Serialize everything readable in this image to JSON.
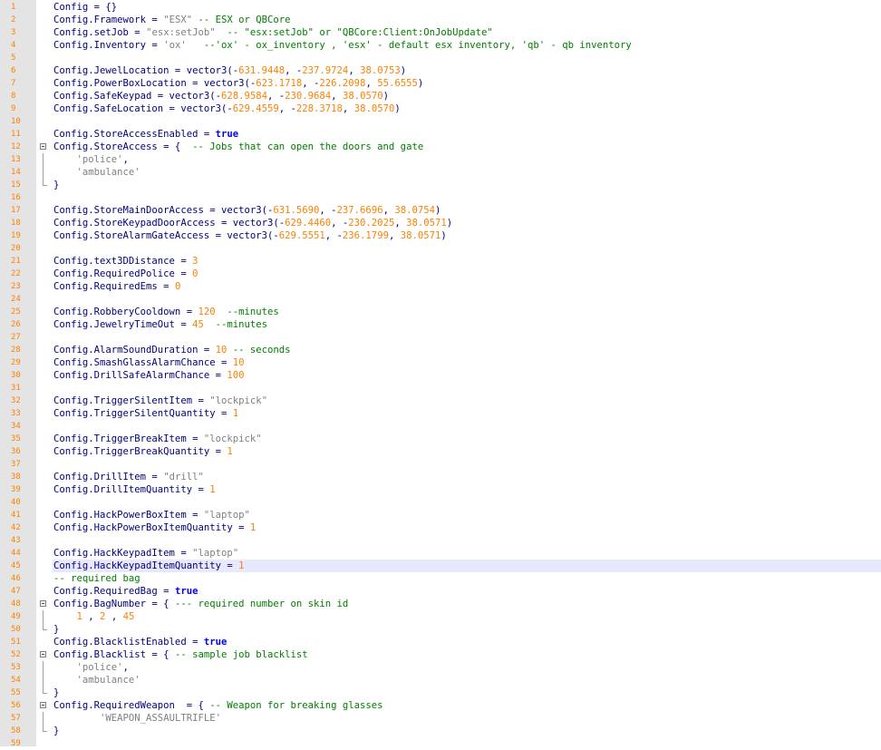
{
  "current_line": 45,
  "colors": {
    "default": "#000080",
    "string": "#808080",
    "number": "#ff8000",
    "keyword": "#0000ff",
    "comment": "#008000",
    "gutter": "#e4e4e4",
    "current_line": "#e8e8ff"
  },
  "lines": [
    {
      "n": "1",
      "fold": "",
      "t": [
        [
          "Config = {}",
          "p"
        ]
      ]
    },
    {
      "n": "2",
      "fold": "",
      "t": [
        [
          "Config.Framework = ",
          "p"
        ],
        [
          "\"ESX\"",
          "s"
        ],
        [
          " -- ESX or QBCore",
          "c"
        ]
      ]
    },
    {
      "n": "3",
      "fold": "",
      "t": [
        [
          "Config.setJob = ",
          "p"
        ],
        [
          "\"esx:setJob\"",
          "s"
        ],
        [
          "  -- \"esx:setJob\" or \"QBCore:Client:OnJobUpdate\"",
          "c"
        ]
      ]
    },
    {
      "n": "4",
      "fold": "",
      "t": [
        [
          "Config.Inventory = ",
          "p"
        ],
        [
          "'ox'",
          "s"
        ],
        [
          "   --'ox' - ox_inventory , 'esx' - default esx inventory, 'qb' - qb inventory",
          "c"
        ]
      ]
    },
    {
      "n": "5",
      "fold": "",
      "t": []
    },
    {
      "n": "6",
      "fold": "",
      "t": [
        [
          "Config.JewelLocation = vector3(-",
          "p"
        ],
        [
          "631.9448",
          "n"
        ],
        [
          ", -",
          "p"
        ],
        [
          "237.9724",
          "n"
        ],
        [
          ", ",
          "p"
        ],
        [
          "38.0753",
          "n"
        ],
        [
          ")",
          "p"
        ]
      ]
    },
    {
      "n": "7",
      "fold": "",
      "t": [
        [
          "Config.PowerBoxLocation = vector3(-",
          "p"
        ],
        [
          "623.1718",
          "n"
        ],
        [
          ", -",
          "p"
        ],
        [
          "226.2098",
          "n"
        ],
        [
          ", ",
          "p"
        ],
        [
          "55.6555",
          "n"
        ],
        [
          ")",
          "p"
        ]
      ]
    },
    {
      "n": "8",
      "fold": "",
      "t": [
        [
          "Config.SafeKeypad = vector3(-",
          "p"
        ],
        [
          "628.9584",
          "n"
        ],
        [
          ", -",
          "p"
        ],
        [
          "230.9684",
          "n"
        ],
        [
          ", ",
          "p"
        ],
        [
          "38.0570",
          "n"
        ],
        [
          ")",
          "p"
        ]
      ]
    },
    {
      "n": "9",
      "fold": "",
      "t": [
        [
          "Config.SafeLocation = vector3(-",
          "p"
        ],
        [
          "629.4559",
          "n"
        ],
        [
          ", -",
          "p"
        ],
        [
          "228.3718",
          "n"
        ],
        [
          ", ",
          "p"
        ],
        [
          "38.0570",
          "n"
        ],
        [
          ")",
          "p"
        ]
      ]
    },
    {
      "n": "10",
      "fold": "",
      "t": []
    },
    {
      "n": "11",
      "fold": "",
      "t": [
        [
          "Config.StoreAccessEnabled = ",
          "p"
        ],
        [
          "true",
          "k"
        ]
      ]
    },
    {
      "n": "12",
      "fold": "open",
      "t": [
        [
          "Config.StoreAccess = {  ",
          "p"
        ],
        [
          "-- Jobs that can open the doors and gate",
          "c"
        ]
      ]
    },
    {
      "n": "13",
      "fold": "line",
      "t": [
        [
          "    ",
          "p"
        ],
        [
          "'police'",
          "s"
        ],
        [
          ",",
          "p"
        ]
      ]
    },
    {
      "n": "14",
      "fold": "line",
      "t": [
        [
          "    ",
          "p"
        ],
        [
          "'ambulance'",
          "s"
        ]
      ]
    },
    {
      "n": "15",
      "fold": "end",
      "t": [
        [
          "}",
          "p"
        ]
      ]
    },
    {
      "n": "16",
      "fold": "",
      "t": []
    },
    {
      "n": "17",
      "fold": "",
      "t": [
        [
          "Config.StoreMainDoorAccess = vector3(-",
          "p"
        ],
        [
          "631.5690",
          "n"
        ],
        [
          ", -",
          "p"
        ],
        [
          "237.6696",
          "n"
        ],
        [
          ", ",
          "p"
        ],
        [
          "38.0754",
          "n"
        ],
        [
          ")",
          "p"
        ]
      ]
    },
    {
      "n": "18",
      "fold": "",
      "t": [
        [
          "Config.StoreKeypadDoorAccess = vector3(-",
          "p"
        ],
        [
          "629.4460",
          "n"
        ],
        [
          ", -",
          "p"
        ],
        [
          "230.2025",
          "n"
        ],
        [
          ", ",
          "p"
        ],
        [
          "38.0571",
          "n"
        ],
        [
          ")",
          "p"
        ]
      ]
    },
    {
      "n": "19",
      "fold": "",
      "t": [
        [
          "Config.StoreAlarmGateAccess = vector3(-",
          "p"
        ],
        [
          "629.5551",
          "n"
        ],
        [
          ", -",
          "p"
        ],
        [
          "236.1799",
          "n"
        ],
        [
          ", ",
          "p"
        ],
        [
          "38.0571",
          "n"
        ],
        [
          ")",
          "p"
        ]
      ]
    },
    {
      "n": "20",
      "fold": "",
      "t": []
    },
    {
      "n": "21",
      "fold": "",
      "t": [
        [
          "Config.text3DDistance = ",
          "p"
        ],
        [
          "3",
          "n"
        ]
      ]
    },
    {
      "n": "22",
      "fold": "",
      "t": [
        [
          "Config.RequiredPolice = ",
          "p"
        ],
        [
          "0",
          "n"
        ]
      ]
    },
    {
      "n": "23",
      "fold": "",
      "t": [
        [
          "Config.RequiredEms = ",
          "p"
        ],
        [
          "0",
          "n"
        ]
      ]
    },
    {
      "n": "24",
      "fold": "",
      "t": []
    },
    {
      "n": "25",
      "fold": "",
      "t": [
        [
          "Config.RobberyCooldown = ",
          "p"
        ],
        [
          "120",
          "n"
        ],
        [
          "  --minutes",
          "c"
        ]
      ]
    },
    {
      "n": "26",
      "fold": "",
      "t": [
        [
          "Config.JewelryTimeOut = ",
          "p"
        ],
        [
          "45",
          "n"
        ],
        [
          "  --minutes",
          "c"
        ]
      ]
    },
    {
      "n": "27",
      "fold": "",
      "t": []
    },
    {
      "n": "28",
      "fold": "",
      "t": [
        [
          "Config.AlarmSoundDuration = ",
          "p"
        ],
        [
          "10",
          "n"
        ],
        [
          " -- seconds",
          "c"
        ]
      ]
    },
    {
      "n": "29",
      "fold": "",
      "t": [
        [
          "Config.SmashGlassAlarmChance = ",
          "p"
        ],
        [
          "10",
          "n"
        ]
      ]
    },
    {
      "n": "30",
      "fold": "",
      "t": [
        [
          "Config.DrillSafeAlarmChance = ",
          "p"
        ],
        [
          "100",
          "n"
        ]
      ]
    },
    {
      "n": "31",
      "fold": "",
      "t": []
    },
    {
      "n": "32",
      "fold": "",
      "t": [
        [
          "Config.TriggerSilentItem = ",
          "p"
        ],
        [
          "\"lockpick\"",
          "s"
        ]
      ]
    },
    {
      "n": "33",
      "fold": "",
      "t": [
        [
          "Config.TriggerSilentQuantity = ",
          "p"
        ],
        [
          "1",
          "n"
        ]
      ]
    },
    {
      "n": "34",
      "fold": "",
      "t": []
    },
    {
      "n": "35",
      "fold": "",
      "t": [
        [
          "Config.TriggerBreakItem = ",
          "p"
        ],
        [
          "\"lockpick\"",
          "s"
        ]
      ]
    },
    {
      "n": "36",
      "fold": "",
      "t": [
        [
          "Config.TriggerBreakQuantity = ",
          "p"
        ],
        [
          "1",
          "n"
        ]
      ]
    },
    {
      "n": "37",
      "fold": "",
      "t": []
    },
    {
      "n": "38",
      "fold": "",
      "t": [
        [
          "Config.DrillItem = ",
          "p"
        ],
        [
          "\"drill\"",
          "s"
        ]
      ]
    },
    {
      "n": "39",
      "fold": "",
      "t": [
        [
          "Config.DrillItemQuantity = ",
          "p"
        ],
        [
          "1",
          "n"
        ]
      ]
    },
    {
      "n": "40",
      "fold": "",
      "t": []
    },
    {
      "n": "41",
      "fold": "",
      "t": [
        [
          "Config.HackPowerBoxItem = ",
          "p"
        ],
        [
          "\"laptop\"",
          "s"
        ]
      ]
    },
    {
      "n": "42",
      "fold": "",
      "t": [
        [
          "Config.HackPowerBoxItemQuantity = ",
          "p"
        ],
        [
          "1",
          "n"
        ]
      ]
    },
    {
      "n": "43",
      "fold": "",
      "t": []
    },
    {
      "n": "44",
      "fold": "",
      "t": [
        [
          "Config.HackKeypadItem = ",
          "p"
        ],
        [
          "\"laptop\"",
          "s"
        ]
      ]
    },
    {
      "n": "45",
      "fold": "",
      "t": [
        [
          "Config.HackKeypadItemQuantity = ",
          "p"
        ],
        [
          "1",
          "n"
        ]
      ]
    },
    {
      "n": "46",
      "fold": "",
      "t": [
        [
          "-- required bag",
          "c"
        ]
      ]
    },
    {
      "n": "47",
      "fold": "",
      "t": [
        [
          "Config.RequiredBag = ",
          "p"
        ],
        [
          "true",
          "k"
        ]
      ]
    },
    {
      "n": "48",
      "fold": "open",
      "t": [
        [
          "Config.BagNumber = { ",
          "p"
        ],
        [
          "--- required number on skin id",
          "c"
        ]
      ]
    },
    {
      "n": "49",
      "fold": "line",
      "t": [
        [
          "    ",
          "p"
        ],
        [
          "1",
          "n"
        ],
        [
          " , ",
          "p"
        ],
        [
          "2",
          "n"
        ],
        [
          " , ",
          "p"
        ],
        [
          "45",
          "n"
        ]
      ]
    },
    {
      "n": "50",
      "fold": "end",
      "t": [
        [
          "}",
          "p"
        ]
      ]
    },
    {
      "n": "51",
      "fold": "",
      "t": [
        [
          "Config.BlacklistEnabled = ",
          "p"
        ],
        [
          "true",
          "k"
        ]
      ]
    },
    {
      "n": "52",
      "fold": "open",
      "t": [
        [
          "Config.Blacklist = { ",
          "p"
        ],
        [
          "-- sample job blacklist",
          "c"
        ]
      ]
    },
    {
      "n": "53",
      "fold": "line",
      "t": [
        [
          "    ",
          "p"
        ],
        [
          "'police'",
          "s"
        ],
        [
          ",",
          "p"
        ]
      ]
    },
    {
      "n": "54",
      "fold": "line",
      "t": [
        [
          "    ",
          "p"
        ],
        [
          "'ambulance'",
          "s"
        ]
      ]
    },
    {
      "n": "55",
      "fold": "end",
      "t": [
        [
          "}",
          "p"
        ]
      ]
    },
    {
      "n": "56",
      "fold": "open",
      "t": [
        [
          "Config.RequiredWeapon  = { ",
          "p"
        ],
        [
          "-- Weapon for breaking glasses",
          "c"
        ]
      ]
    },
    {
      "n": "57",
      "fold": "line",
      "t": [
        [
          "        ",
          "p"
        ],
        [
          "'WEAPON_ASSAULTRIFLE'",
          "s"
        ]
      ]
    },
    {
      "n": "58",
      "fold": "end",
      "t": [
        [
          "}",
          "p"
        ]
      ]
    },
    {
      "n": "59",
      "fold": "",
      "t": []
    }
  ]
}
